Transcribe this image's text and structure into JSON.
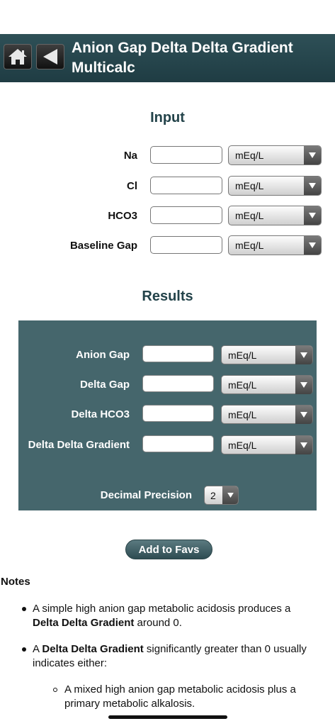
{
  "header": {
    "title": "Anion Gap Delta Delta Gradient Multicalc",
    "home_icon": "home-icon",
    "back_icon": "back-arrow-icon"
  },
  "input": {
    "section_title": "Input",
    "rows": [
      {
        "label": "Na",
        "value": "",
        "unit": "mEq/L"
      },
      {
        "label": "Cl",
        "value": "",
        "unit": "mEq/L"
      },
      {
        "label": "HCO3",
        "value": "",
        "unit": "mEq/L"
      },
      {
        "label": "Baseline Gap",
        "value": "",
        "unit": "mEq/L"
      }
    ]
  },
  "results": {
    "section_title": "Results",
    "rows": [
      {
        "label": "Anion Gap",
        "value": "",
        "unit": "mEq/L"
      },
      {
        "label": "Delta Gap",
        "value": "",
        "unit": "mEq/L"
      },
      {
        "label": "Delta HCO3",
        "value": "",
        "unit": "mEq/L"
      },
      {
        "label": "Delta Delta Gradient",
        "value": "",
        "unit": "mEq/L"
      }
    ],
    "precision_label": "Decimal Precision",
    "precision_value": "2"
  },
  "favs_button": "Add to Favs",
  "notes": {
    "title": "Notes",
    "n1_a": "A simple high anion gap metabolic acidosis produces a",
    "n1_b": "Delta Delta Gradient",
    "n1_c": " around 0.",
    "n2_a": "A ",
    "n2_b": "Delta Delta Gradient",
    "n2_c": " significantly greater than 0 usually",
    "n2_d": "indicates either:",
    "n3_a": "A mixed high anion gap metabolic acidosis plus a",
    "n3_b": "primary metabolic alkalosis."
  },
  "colors": {
    "header_bg": "#1f3c43",
    "panel_bg": "#45666c",
    "section_title": "#23434a"
  }
}
